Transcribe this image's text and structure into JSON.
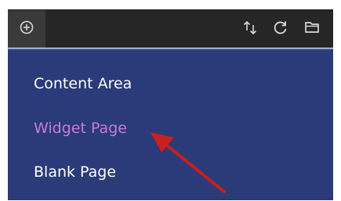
{
  "toolbar": {
    "icons": {
      "add": "plus-circle-icon",
      "sort": "sort-arrows-icon",
      "refresh": "refresh-icon",
      "folder": "folder-icon"
    }
  },
  "menu": {
    "items": [
      {
        "label": "Content Area",
        "active": false
      },
      {
        "label": "Widget Page",
        "active": true
      },
      {
        "label": "Blank Page",
        "active": false
      }
    ]
  },
  "colors": {
    "toolbar_bg": "#262626",
    "menu_bg": "#2b3a78",
    "active_item": "#c77bd8",
    "annotation_arrow": "#c8201e"
  }
}
